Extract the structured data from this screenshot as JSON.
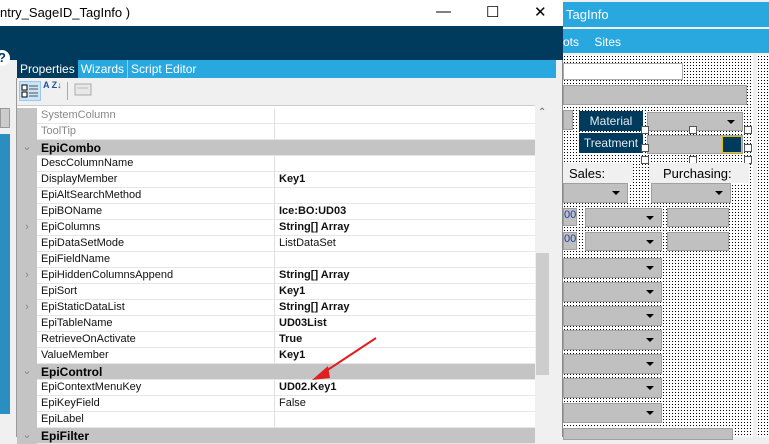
{
  "window": {
    "title": "ntry_SageID_TagInfo )",
    "minimize": "—",
    "maximize": "☐",
    "close": "✕",
    "help": "?"
  },
  "tabs": [
    "Properties",
    "Wizards",
    "Script Editor"
  ],
  "toolbar": {
    "categorized": "categorized-icon",
    "alphabetical": "A Z↓",
    "property_pages": "property-pages-icon"
  },
  "grid": {
    "rows": [
      {
        "name": "SystemColumn",
        "value": "",
        "dim": true
      },
      {
        "name": "ToolTip",
        "value": "",
        "dim": true
      },
      {
        "name": "EpiCombo",
        "category": true,
        "glyph": "⌄"
      },
      {
        "name": "DescColumnName",
        "value": ""
      },
      {
        "name": "DisplayMember",
        "value": "Key1",
        "bold": true
      },
      {
        "name": "EpiAltSearchMethod",
        "value": ""
      },
      {
        "name": "EpiBOName",
        "value": "Ice:BO:UD03",
        "bold": true
      },
      {
        "name": "EpiColumns",
        "value": "String[] Array",
        "bold": true,
        "glyph": "›"
      },
      {
        "name": "EpiDataSetMode",
        "value": "ListDataSet"
      },
      {
        "name": "EpiFieldName",
        "value": ""
      },
      {
        "name": "EpiHiddenColumnsAppend",
        "value": "String[] Array",
        "bold": true,
        "glyph": "›"
      },
      {
        "name": "EpiSort",
        "value": "Key1",
        "bold": true
      },
      {
        "name": "EpiStaticDataList",
        "value": "String[] Array",
        "bold": true,
        "glyph": "›"
      },
      {
        "name": "EpiTableName",
        "value": "UD03List",
        "bold": true
      },
      {
        "name": "RetrieveOnActivate",
        "value": "True",
        "bold": true
      },
      {
        "name": "ValueMember",
        "value": "Key1",
        "bold": true
      },
      {
        "name": "EpiControl",
        "category": true,
        "glyph": "⌄"
      },
      {
        "name": "EpiContextMenuKey",
        "value": "UD02.Key1",
        "bold": true
      },
      {
        "name": "EpiKeyField",
        "value": "False"
      },
      {
        "name": "EpiLabel",
        "value": ""
      },
      {
        "name": "EpiFilter",
        "category": true,
        "glyph": "⌄"
      }
    ]
  },
  "background_app": {
    "title": "TagInfo",
    "menu": [
      "ots",
      "Sites"
    ],
    "labels": {
      "material": "Material",
      "treatment": "Treatment",
      "sales": "Sales:",
      "purchasing": "Purchasing:",
      "num1": "00",
      "num2": "00"
    }
  },
  "colors": {
    "navy": "#003a5c",
    "accent": "#29a8e0",
    "arrow": "#e02020"
  }
}
